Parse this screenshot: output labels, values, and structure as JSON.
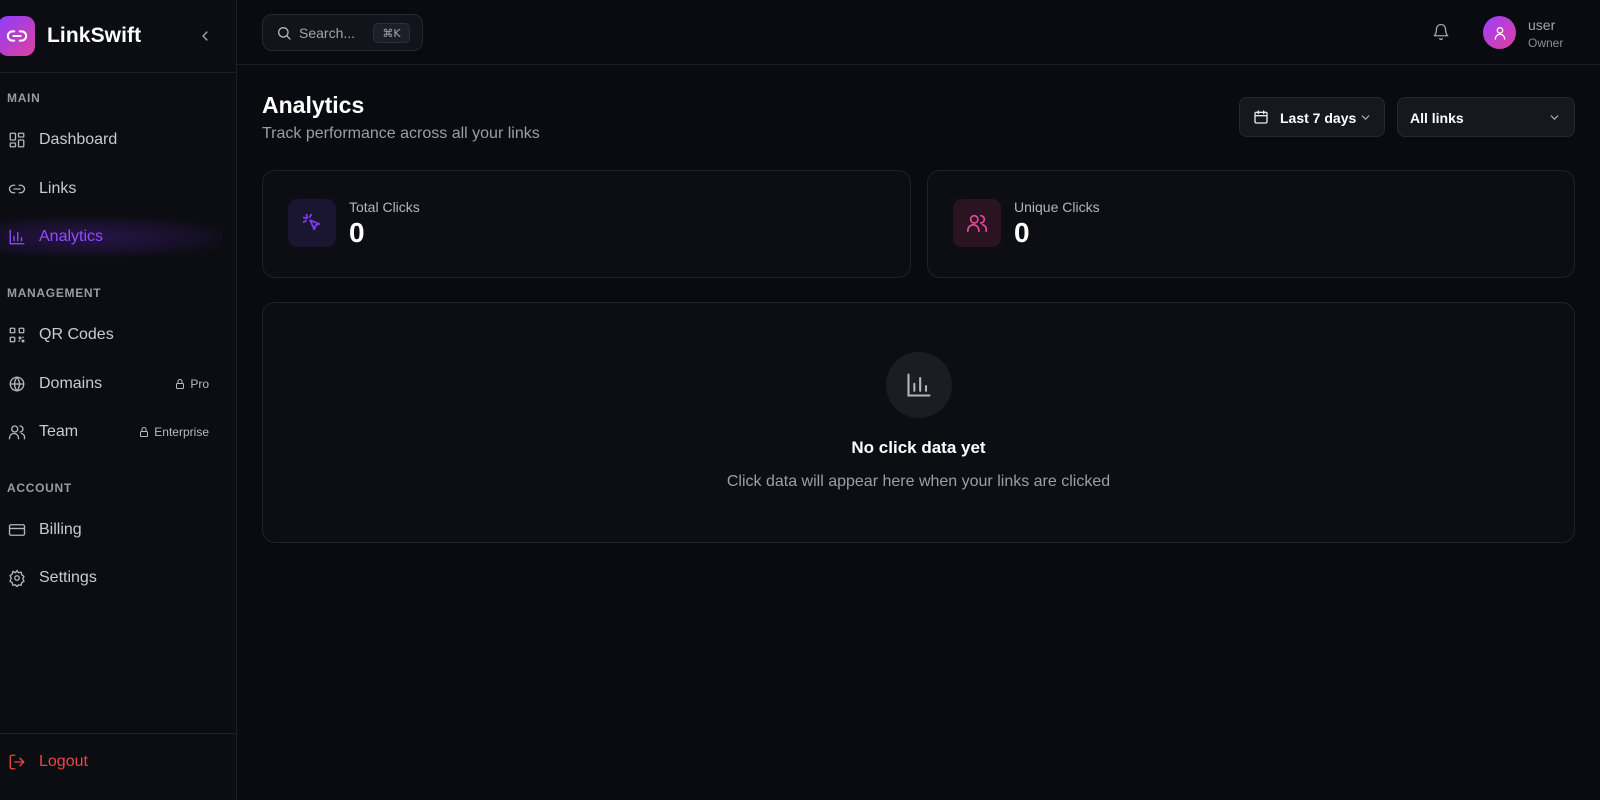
{
  "brand": {
    "name": "LinkSwift"
  },
  "sidebar": {
    "sections": {
      "main": "MAIN",
      "management": "MANAGEMENT",
      "account": "ACCOUNT"
    },
    "items": [
      {
        "label": "Dashboard",
        "icon": "dashboard-icon"
      },
      {
        "label": "Links",
        "icon": "link-icon"
      },
      {
        "label": "Analytics",
        "icon": "bar-chart-icon",
        "active": true
      },
      {
        "label": "QR Codes",
        "icon": "qr-code-icon"
      },
      {
        "label": "Domains",
        "icon": "globe-icon",
        "badge": "Pro"
      },
      {
        "label": "Team",
        "icon": "users-icon",
        "badge": "Enterprise"
      },
      {
        "label": "Billing",
        "icon": "credit-card-icon"
      },
      {
        "label": "Settings",
        "icon": "gear-icon"
      }
    ],
    "logout": "Logout"
  },
  "topbar": {
    "search": {
      "placeholder": "Search...",
      "shortcut": "⌘K"
    },
    "user": {
      "name": "user",
      "role": "Owner"
    }
  },
  "page": {
    "title": "Analytics",
    "subtitle": "Track performance across all your links",
    "date_range": "Last 7 days",
    "link_filter": "All links"
  },
  "stats": [
    {
      "label": "Total Clicks",
      "value": "0",
      "color": "#7c3aed"
    },
    {
      "label": "Unique Clicks",
      "value": "0",
      "color": "#ec4899"
    }
  ],
  "empty_state": {
    "title": "No click data yet",
    "description": "Click data will appear here when your links are clicked"
  },
  "colors": {
    "accent": "#8f4dff",
    "brand_gradient_start": "#8b3dff",
    "brand_gradient_end": "#e0409b",
    "danger": "#ef4444",
    "background": "#0a0b10"
  }
}
